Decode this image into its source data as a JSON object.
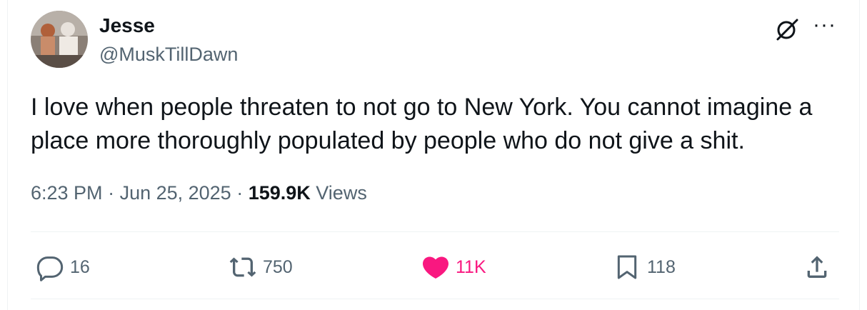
{
  "author": {
    "name": "Jesse",
    "handle": "@MuskTillDawn"
  },
  "tweet": {
    "text": "I love when people threaten to not go to New York. You cannot imagine a place more thoroughly populated by people who do not give a shit."
  },
  "meta": {
    "time": "6:23 PM",
    "sep1": " · ",
    "date": "Jun 25, 2025",
    "sep2": " · ",
    "views_count": "159.9K",
    "views_label": " Views"
  },
  "actions": {
    "replies": "16",
    "reposts": "750",
    "likes": "11K",
    "bookmarks": "118"
  },
  "icons": {
    "reply": "reply-icon",
    "repost": "repost-icon",
    "like": "heart-icon",
    "bookmark": "bookmark-icon",
    "share": "share-icon",
    "grok": "grok-icon",
    "more": "more-icon"
  },
  "colors": {
    "text": "#0f1419",
    "muted": "#536471",
    "like": "#f91880"
  }
}
